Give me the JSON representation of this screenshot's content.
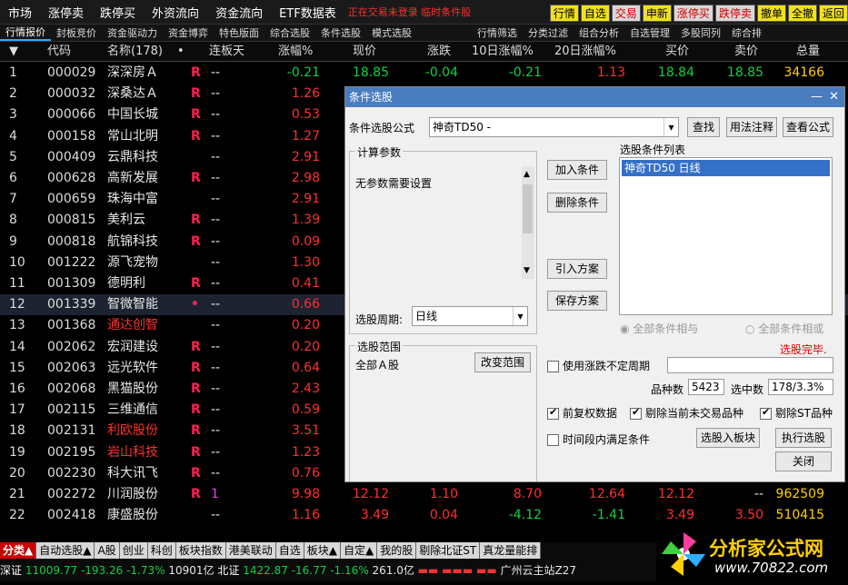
{
  "menu": {
    "items": [
      "市场",
      "涨停卖",
      "跌停买",
      "外资流向",
      "资金流向",
      "ETF数据表"
    ],
    "status": "正在交易未登录  临时条件股",
    "right_buttons": [
      "行情",
      "自选",
      "交易",
      "申新",
      "涨停买",
      "跌停卖",
      "撤单",
      "全撤",
      "返回"
    ]
  },
  "subtabs": [
    "行情报价",
    "封板竞价",
    "资金驱动力",
    "资金博弈",
    "特色版面",
    "综合选股",
    "条件选股",
    "模式选股",
    "行情筛选",
    "分类过滤",
    "组合分析",
    "自选管理",
    "多股同列",
    "综合排"
  ],
  "table": {
    "headers": [
      "代码",
      "名称(178)",
      "•",
      "连板天",
      "涨幅%",
      "现价",
      "涨跌",
      "10日涨幅%",
      "20日涨幅%",
      "买价",
      "卖价",
      "总量"
    ],
    "rows": [
      {
        "n": "1",
        "code": "000029",
        "name": "深深房Ａ",
        "r": "R",
        "lb": "--",
        "pct": "-0.21",
        "price": "18.85",
        "chg": "-0.04",
        "d10": "-0.21",
        "d20": "1.13",
        "bid": "18.84",
        "ask": "18.85",
        "vol": "34166",
        "pc": "grn",
        "namec": "wht",
        "volc": "yel"
      },
      {
        "n": "2",
        "code": "000032",
        "name": "深桑达Ａ",
        "r": "R",
        "lb": "--",
        "pct": "1.26",
        "pc": "red",
        "namec": "wht"
      },
      {
        "n": "3",
        "code": "000066",
        "name": "中国长城",
        "r": "R",
        "lb": "--",
        "pct": "0.53",
        "pc": "red",
        "namec": "wht"
      },
      {
        "n": "4",
        "code": "000158",
        "name": "常山北明",
        "r": "R",
        "lb": "--",
        "pct": "1.27",
        "pc": "red",
        "namec": "wht"
      },
      {
        "n": "5",
        "code": "000409",
        "name": "云鼎科技",
        "r": "",
        "lb": "--",
        "pct": "2.91",
        "pc": "red",
        "namec": "wht"
      },
      {
        "n": "6",
        "code": "000628",
        "name": "高新发展",
        "r": "R",
        "lb": "--",
        "pct": "2.98",
        "pc": "red",
        "namec": "wht"
      },
      {
        "n": "7",
        "code": "000659",
        "name": "珠海中富",
        "r": "",
        "lb": "--",
        "pct": "2.91",
        "pc": "red",
        "namec": "wht"
      },
      {
        "n": "8",
        "code": "000815",
        "name": "美利云",
        "r": "R",
        "lb": "--",
        "pct": "1.39",
        "pc": "red",
        "namec": "wht"
      },
      {
        "n": "9",
        "code": "000818",
        "name": "航锦科技",
        "r": "R",
        "lb": "--",
        "pct": "0.09",
        "pc": "red",
        "namec": "wht"
      },
      {
        "n": "10",
        "code": "001222",
        "name": "源飞宠物",
        "r": "",
        "lb": "--",
        "pct": "1.30",
        "pc": "red",
        "namec": "wht"
      },
      {
        "n": "11",
        "code": "001309",
        "name": "德明利",
        "r": "R",
        "lb": "--",
        "pct": "0.41",
        "pc": "red",
        "namec": "wht"
      },
      {
        "n": "12",
        "code": "001339",
        "name": "智微智能",
        "r": "•",
        "lb": "--",
        "pct": "0.66",
        "pc": "red",
        "namec": "wht",
        "sel": true
      },
      {
        "n": "13",
        "code": "001368",
        "name": "通达创智",
        "r": "",
        "lb": "--",
        "pct": "0.20",
        "pc": "red",
        "namec": "red"
      },
      {
        "n": "14",
        "code": "002062",
        "name": "宏润建设",
        "r": "R",
        "lb": "--",
        "pct": "0.20",
        "pc": "red",
        "namec": "wht"
      },
      {
        "n": "15",
        "code": "002063",
        "name": "远光软件",
        "r": "R",
        "lb": "--",
        "pct": "0.64",
        "pc": "red",
        "namec": "wht"
      },
      {
        "n": "16",
        "code": "002068",
        "name": "黑猫股份",
        "r": "R",
        "lb": "--",
        "pct": "2.43",
        "pc": "red",
        "namec": "wht"
      },
      {
        "n": "17",
        "code": "002115",
        "name": "三维通信",
        "r": "R",
        "lb": "--",
        "pct": "0.59",
        "pc": "red",
        "namec": "wht"
      },
      {
        "n": "18",
        "code": "002131",
        "name": "利欧股份",
        "r": "R",
        "lb": "--",
        "pct": "3.51",
        "pc": "red",
        "namec": "red"
      },
      {
        "n": "19",
        "code": "002195",
        "name": "岩山科技",
        "r": "R",
        "lb": "--",
        "pct": "1.23",
        "pc": "red",
        "namec": "red"
      },
      {
        "n": "20",
        "code": "002230",
        "name": "科大讯飞",
        "r": "R",
        "lb": "--",
        "pct": "0.76",
        "pc": "red",
        "namec": "wht"
      },
      {
        "n": "21",
        "code": "002272",
        "name": "川润股份",
        "r": "R",
        "lb": "1",
        "pct": "9.98",
        "price": "12.12",
        "chg": "1.10",
        "d10": "8.70",
        "d20": "12.64",
        "bid": "12.12",
        "ask": "--",
        "vol": "962509",
        "pc": "red",
        "namec": "wht",
        "volc": "yel"
      },
      {
        "n": "22",
        "code": "002418",
        "name": "康盛股份",
        "r": "",
        "lb": "--",
        "pct": "1.16",
        "price": "3.49",
        "chg": "0.04",
        "d10": "-4.12",
        "d20": "-1.41",
        "bid": "3.49",
        "ask": "3.50",
        "vol": "510415",
        "pc": "red",
        "namec": "wht",
        "volc": "yel"
      }
    ]
  },
  "dialog": {
    "title": "条件选股",
    "formula_label": "条件选股公式",
    "formula_value": "神奇TD50  -",
    "find": "查找",
    "usage": "用法注释",
    "view_formula": "查看公式",
    "params_title": "计算参数",
    "params_text": "无参数需要设置",
    "add": "加入条件",
    "delete": "删除条件",
    "import": "引入方案",
    "save": "保存方案",
    "list_title": "选股条件列表",
    "list_item": "神奇TD50  日线",
    "period_label": "选股周期:",
    "period_value": "日线",
    "all_and": "全部条件相与",
    "all_or": "全部条件相或",
    "done": "选股完毕.",
    "scope_title": "选股范围",
    "scope_value": "全部Ａ股",
    "change_scope": "改变范围",
    "use_period": "使用涨跌不定周期",
    "count_label": "品种数",
    "count_value": "5423",
    "sel_label": "选中数",
    "sel_value": "178/3.3%",
    "pre_adj": "前复权数据",
    "exclude_untraded": "剔除当前未交易品种",
    "exclude_st": "剔除ST品种",
    "time_range": "时间段内满足条件",
    "to_block": "选股入板块",
    "execute": "执行选股",
    "close": "关闭"
  },
  "bottom": {
    "tabs": [
      "分类▲",
      "自动选股▲",
      "A股",
      "创业",
      "科创",
      "板块指数",
      "港美联动",
      "自选",
      "板块▲",
      "自定▲",
      "我的股",
      "剔除北证ST",
      "真龙量能排"
    ],
    "sz_label": "深证",
    "sz_val": "11009.77",
    "sz_chg": "-193.26",
    "sz_pct": "-1.73%",
    "sz_amt": "10901亿",
    "bz_label": "北证",
    "bz_val": "1422.87",
    "bz_chg": "-16.77",
    "bz_pct": "-1.16%",
    "bz_amt": "261.0亿",
    "site": "广州云主站Z27"
  },
  "logo": {
    "title": "分析家公式网",
    "url": "www.70822.com"
  },
  "colors": {
    "up": "#ff3030",
    "down": "#10d040",
    "accent": "#4a7cc0"
  }
}
